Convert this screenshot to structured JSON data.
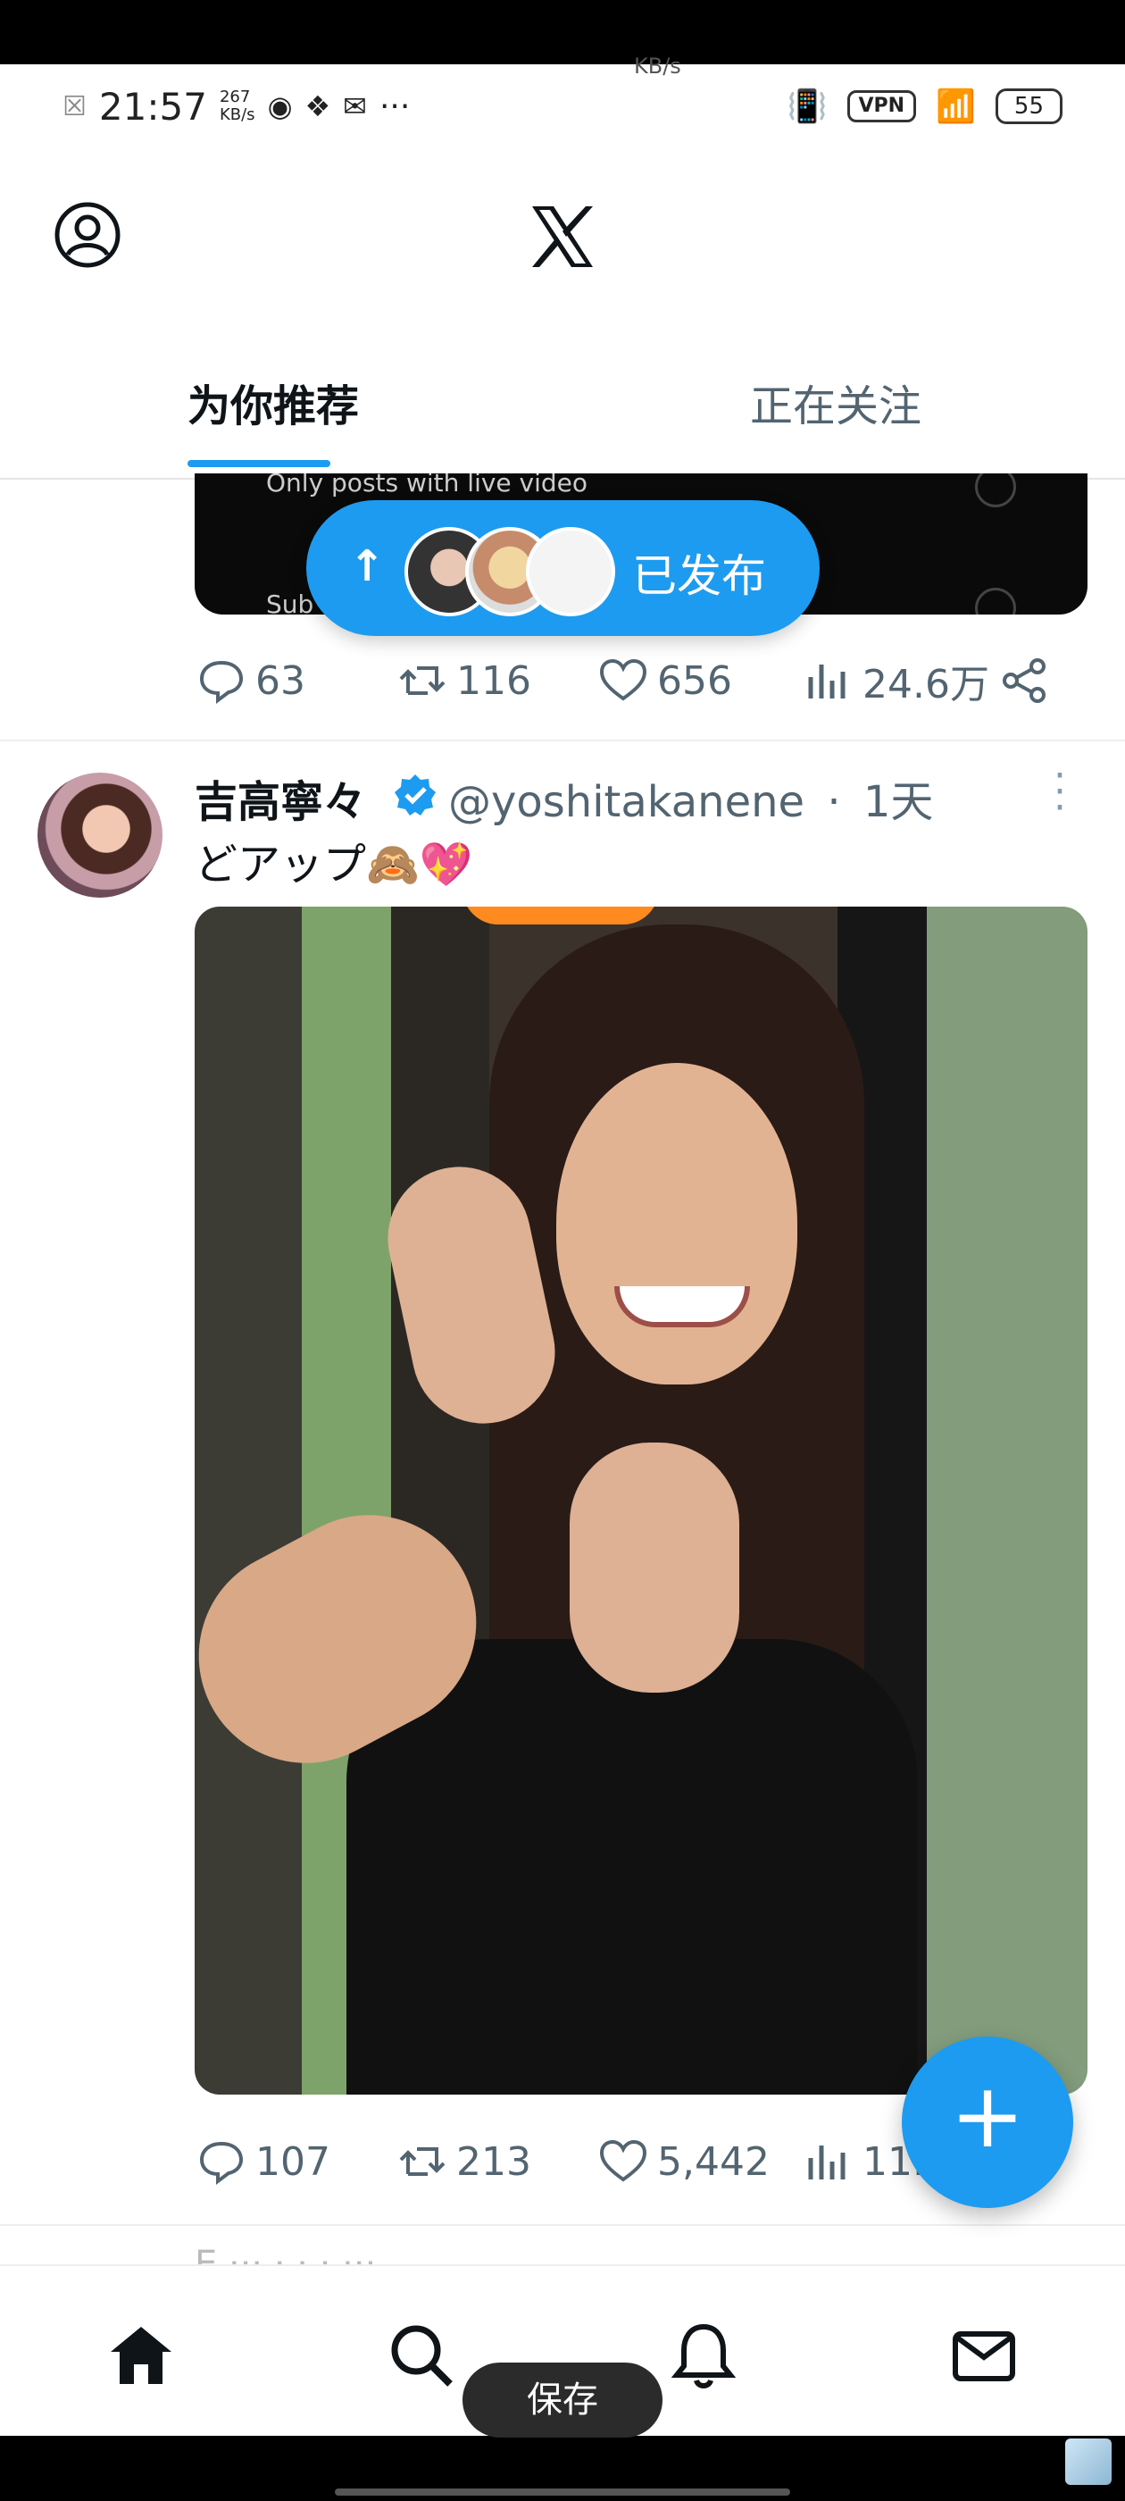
{
  "status_bar": {
    "time": "21:57",
    "net_speed_value": "267",
    "net_speed_unit": "KB/s",
    "more": "···",
    "vpn": "VPN",
    "battery": "55",
    "ghost_text": "KB/s"
  },
  "header": {
    "logo": "x-logo-icon"
  },
  "tabs": [
    {
      "label": "为你推荐",
      "active": true
    },
    {
      "label": "正在关注",
      "active": false
    }
  ],
  "previous_post": {
    "media_text_top": "Only posts with live video",
    "media_text_bottom": "Sub",
    "actions": {
      "replies": "63",
      "reposts": "116",
      "likes": "656",
      "views": "24.6万"
    }
  },
  "new_posts_pill": {
    "label": "已发布"
  },
  "post": {
    "author_name": "吉高寧々",
    "handle": "@yoshitakanene",
    "separator": "·",
    "time": "1天",
    "text": "どアップ🙈💖",
    "actions": {
      "replies": "107",
      "reposts": "213",
      "likes": "5,442",
      "views": "11."
    }
  },
  "next_post_peek": "E   ··· ·   ·  · ···",
  "fab": {
    "label": "+"
  },
  "bottom_nav": [
    "home-icon",
    "search-icon",
    "notifications-icon",
    "messages-icon"
  ],
  "save_button": "保存",
  "colors": {
    "accent": "#1d9bf0",
    "text": "#0f1419",
    "muted": "#536471"
  }
}
